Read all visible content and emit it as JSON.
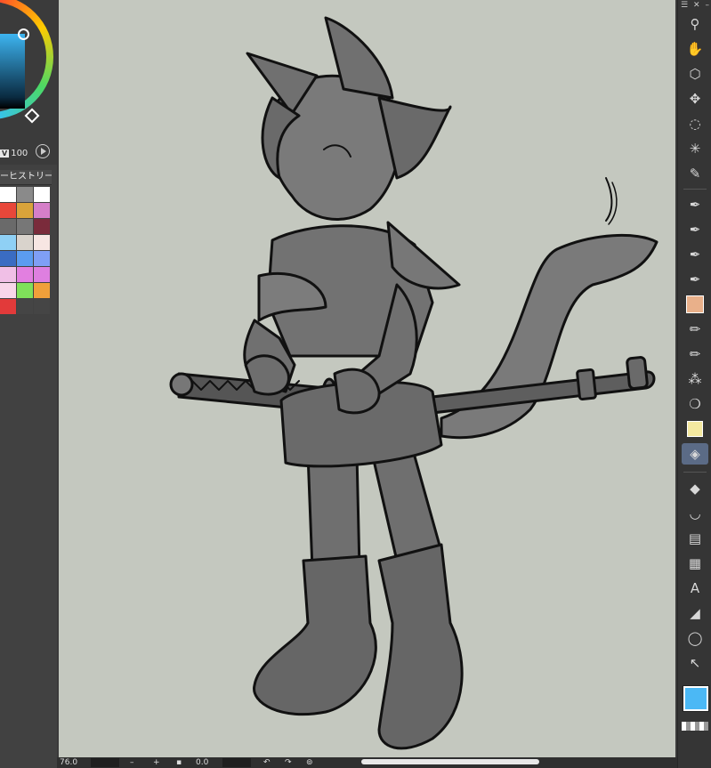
{
  "color_panel": {
    "value_label": "V",
    "value": "100"
  },
  "history_tab": {
    "label": "ーヒストリー"
  },
  "swatch_colors": [
    "#ffffff",
    "#8a8a8a",
    "#ffffff",
    "#e8473a",
    "#d9a33a",
    "#d57fc8",
    "#6a6a6a",
    "#777777",
    "#7a2b3b",
    "#8fd0f5",
    "#d9d3cc",
    "#f7e6e3",
    "#3a6cc2",
    "#5b9cf0",
    "#7f9ff5",
    "#f0bfe6",
    "#e27fe0",
    "#de7fe0",
    "#f8d6ea",
    "#7fe05a",
    "#f0a03a",
    "#e23a3a",
    "#454545",
    "#454545"
  ],
  "toolbar": {
    "active_tool": "eraser",
    "main_color": "#4bb8f5",
    "tools": [
      "zoom",
      "hand",
      "object",
      "move",
      "lasso",
      "magic-wand",
      "eyedropper",
      "pen",
      "pen-2",
      "pen-3",
      "pen-4",
      "brush-preset",
      "pencil",
      "pencil-2",
      "airbrush",
      "watercolor",
      "marker",
      "eraser",
      "fill",
      "curve",
      "gradient",
      "frame",
      "text",
      "ruler",
      "balloon",
      "correction"
    ]
  },
  "bottom_bar": {
    "zoom_value": "76.0",
    "minus_label": "–",
    "plus_label": "+",
    "angle_value": "0.0"
  }
}
